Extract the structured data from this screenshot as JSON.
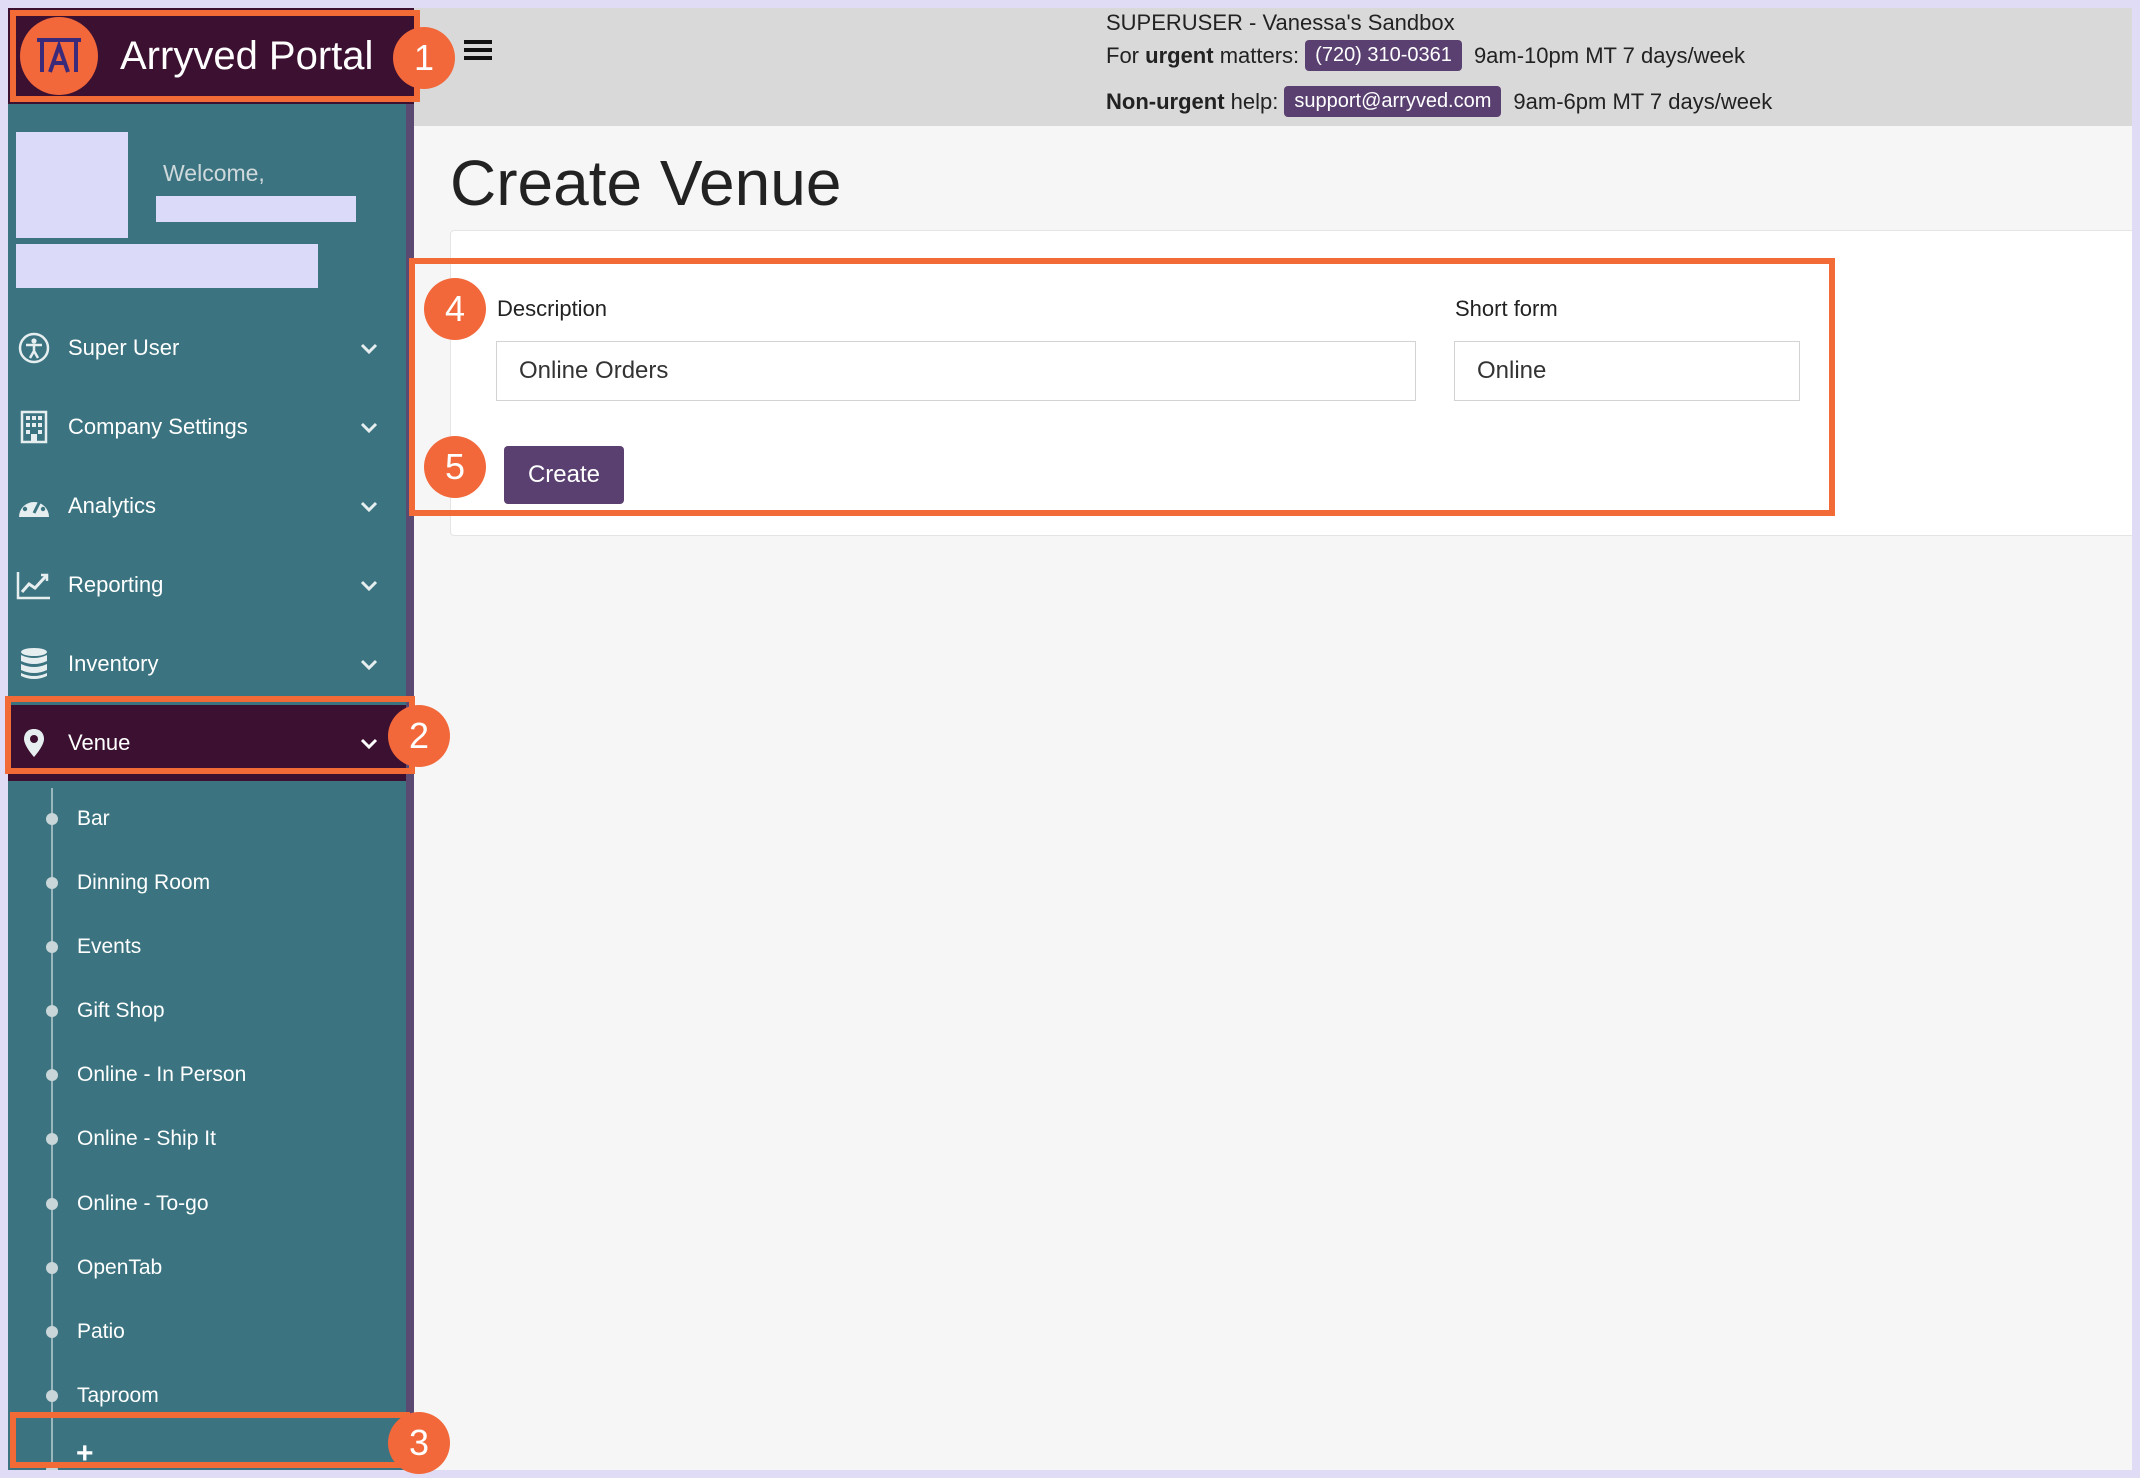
{
  "app": {
    "title": "Arryved Portal",
    "logo_text": "TAT"
  },
  "sidebar": {
    "welcome": "Welcome,",
    "nav": [
      {
        "label": "Super User",
        "icon": "accessibility-icon"
      },
      {
        "label": "Company Settings",
        "icon": "building-icon"
      },
      {
        "label": "Analytics",
        "icon": "dashboard-gauge-icon"
      },
      {
        "label": "Reporting",
        "icon": "line-chart-icon"
      },
      {
        "label": "Inventory",
        "icon": "database-icon"
      },
      {
        "label": "Venue",
        "icon": "map-pin-icon",
        "active": true
      }
    ],
    "venues": [
      "Bar",
      "Dinning Room",
      "Events",
      "Gift Shop",
      "Online - In Person",
      "Online - Ship It",
      "Online - To-go",
      "OpenTab",
      "Patio",
      "Taproom"
    ],
    "add_label": "+"
  },
  "topbar": {
    "account": "SUPERUSER - Vanessa's Sandbox",
    "urgent_prefix": "For ",
    "urgent_bold": "urgent",
    "urgent_suffix": " matters:",
    "urgent_phone": "(720) 310-0361",
    "urgent_hours": "9am-10pm MT 7 days/week",
    "nonurgent_bold": "Non-urgent",
    "nonurgent_suffix": " help:",
    "nonurgent_email": "support@arryved.com",
    "nonurgent_hours": "9am-6pm MT 7 days/week"
  },
  "page": {
    "title": "Create Venue",
    "form": {
      "description_label": "Description",
      "description_value": "Online Orders",
      "short_form_label": "Short form",
      "short_form_value": "Online",
      "submit_label": "Create"
    }
  },
  "annotations": [
    "1",
    "2",
    "3",
    "4",
    "5"
  ],
  "colors": {
    "sidebar": "#3b7480",
    "brand_bg": "#3b1030",
    "accent": "#f2683a",
    "button": "#5a4070"
  }
}
